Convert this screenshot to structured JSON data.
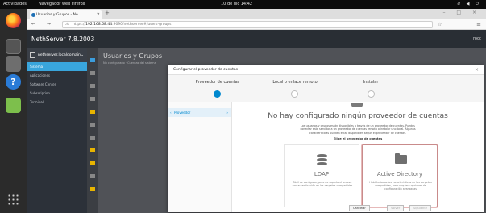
{
  "topbar": {
    "activities": "Actividades",
    "app_menu": "Navegador web Firefox",
    "clock": "10 de dic 14:42",
    "tray": "ⅆ ◀ ⏻"
  },
  "browser": {
    "tab_title": "Usuarios y Grupos - Ne...",
    "url_host": "192.168.68.44",
    "url_rest": ":9090/nethserver#/users-groups",
    "url_prefix": "https://"
  },
  "nethserver": {
    "brand": "NethServer 7.8.2003",
    "user": "root",
    "host": "nethserver.localdomain",
    "sidebar": [
      "Sistema",
      "Aplicaciones",
      "Software Center",
      "Subscription",
      "Terminal"
    ],
    "page_title": "Usuarios y Grupos",
    "page_sub": "No configurado · Cuentas del sistema"
  },
  "wizard": {
    "title": "Configurar el proveedor de cuentas",
    "steps": [
      "Proveedor de cuentas",
      "Local o enlace remoto",
      "Instalar"
    ],
    "nav_item": "Proveedor",
    "empty_title": "No hay configurado ningún proveedor de cuentas",
    "empty_desc": "Los usuarios y grupos están disponibles a través de un proveedor de cuentas. Puedes conectar este servidor a un proveedor de cuentas remoto o instalar uno local. Algunas características pueden estar disponibles según el proveedor de cuentas.",
    "pick": "Elige el proveedor de cuentas",
    "cards": [
      {
        "title": "LDAP",
        "desc": "Fácil de configurar, pero no soporta el acceso con autenticación en las carpetas compartidas"
      },
      {
        "title": "Active Directory",
        "desc": "Habilita todas las características de las carpetas compartidas, pero requiere opciones de configuración avanzadas"
      }
    ],
    "buttons": {
      "cancel": "Cancelar",
      "back": "Volver",
      "next": "Siguiente"
    }
  }
}
